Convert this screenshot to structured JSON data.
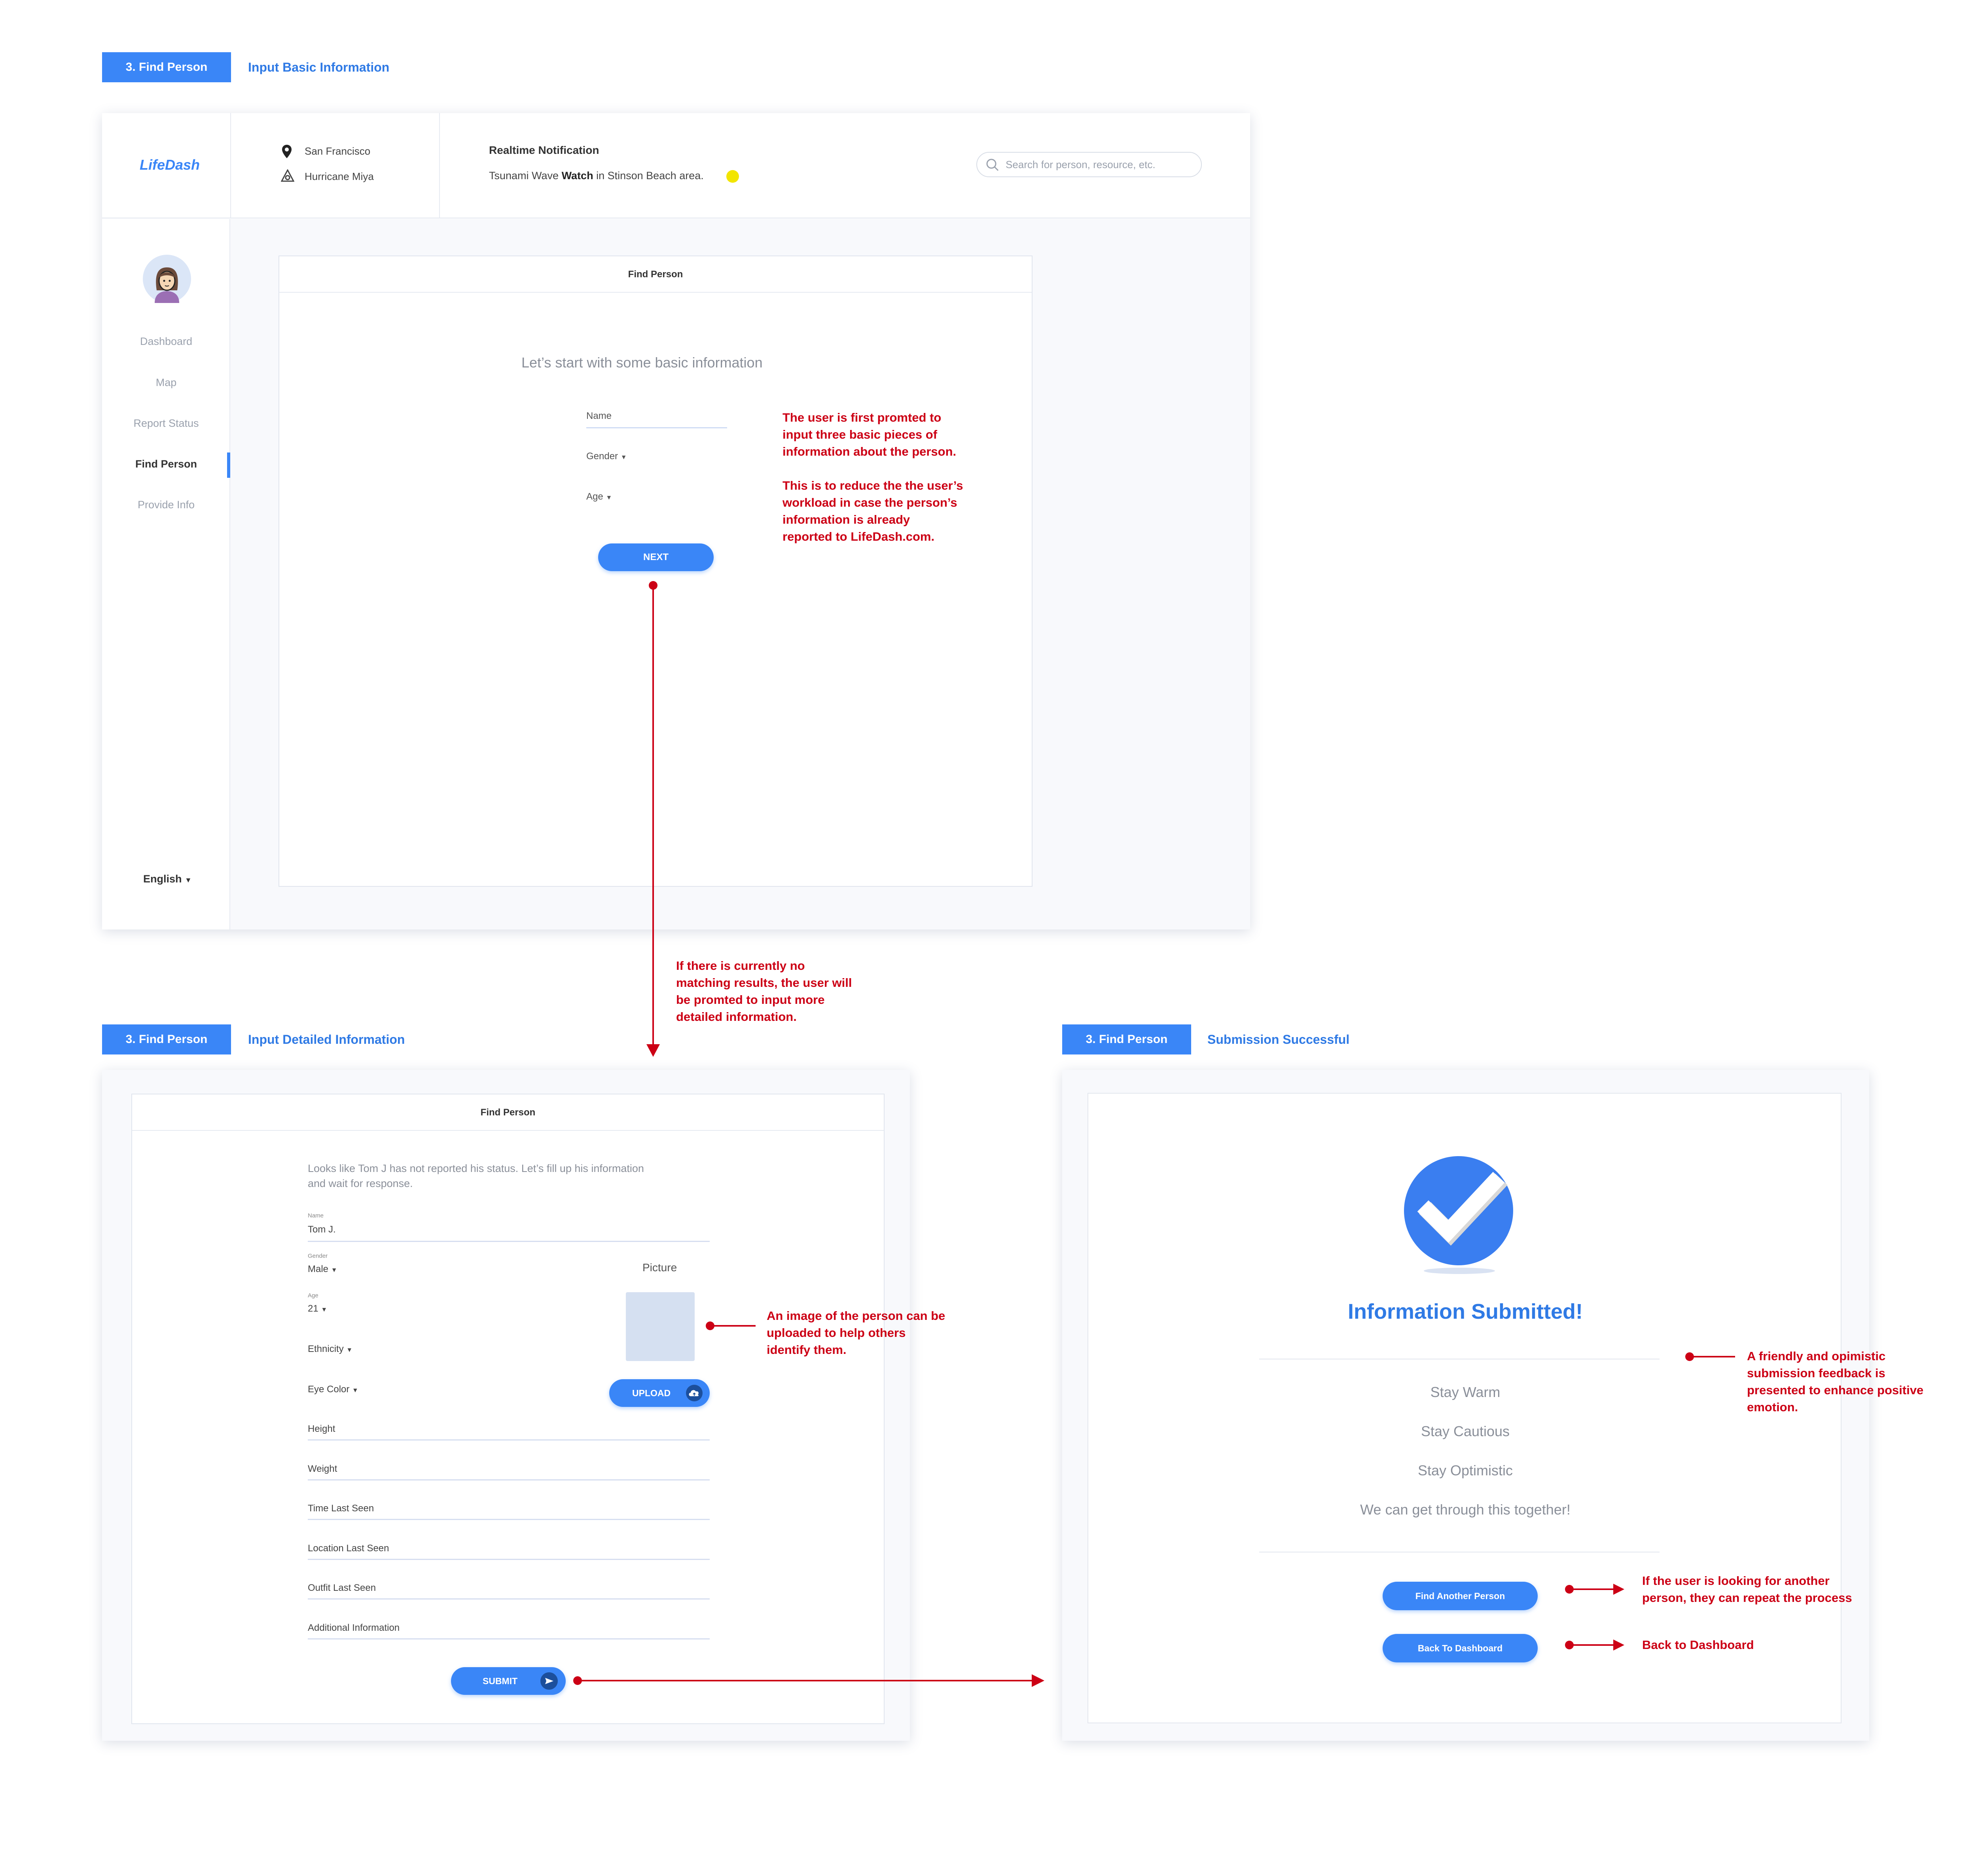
{
  "section1": {
    "tag": "3. Find Person",
    "subtitle": "Input Basic Information"
  },
  "section2": {
    "tag": "3. Find Person",
    "subtitle": "Input Detailed Information"
  },
  "section3": {
    "tag": "3. Find Person",
    "subtitle": "Submission Successful"
  },
  "app": {
    "logo": "LifeDash"
  },
  "header": {
    "location": "San Francisco",
    "hazard": "Hurricane Miya",
    "notif_title": "Realtime Notification",
    "notif_pre": "Tsunami Wave ",
    "notif_bold": "Watch",
    "notif_post": " in Stinson Beach area.",
    "search_placeholder": "Search for person, resource, etc."
  },
  "sidebar": {
    "items": [
      {
        "label": "Dashboard"
      },
      {
        "label": "Map"
      },
      {
        "label": "Report Status"
      },
      {
        "label": "Find Person"
      },
      {
        "label": "Provide Info"
      }
    ],
    "language": "English"
  },
  "basic_form": {
    "card_title": "Find Person",
    "heading": "Let’s start with some basic information",
    "name_label": "Name",
    "gender_label": "Gender",
    "age_label": "Age",
    "next_label": "NEXT"
  },
  "detail_form": {
    "card_title": "Find Person",
    "intro_line1": "Looks like Tom J has not reported his status. Let’s fill up his information",
    "intro_line2": "and wait for response.",
    "name_small": "Name",
    "name_value": "Tom J.",
    "gender_small": "Gender",
    "gender_value": "Male",
    "age_small": "Age",
    "age_value": "21",
    "ethnicity": "Ethnicity",
    "eye_color": "Eye Color",
    "height": "Height",
    "weight": "Weight",
    "time_last_seen": "Time Last Seen",
    "location_last_seen": "Location Last Seen",
    "outfit_last_seen": "Outfit Last Seen",
    "additional_info": "Additional Information",
    "picture_label": "Picture",
    "upload_label": "UPLOAD",
    "submit_label": "SUBMIT"
  },
  "success": {
    "title": "Information Submitted!",
    "line1": "Stay Warm",
    "line2": "Stay Cautious",
    "line3": "Stay Optimistic",
    "line4": "We can get through this together!",
    "find_another": "Find Another Person",
    "back_dashboard": "Back To Dashboard"
  },
  "annotations": {
    "a1_p1": [
      "The user is first promted to",
      "input three basic pieces of",
      "information about the person."
    ],
    "a1_p2": [
      "This is to reduce the the user’s",
      "workload in case the person’s",
      "information is already",
      "reported to LifeDash.com."
    ],
    "a2": [
      "If there is currently no",
      "matching results, the user will",
      "be promted to input more",
      "detailed information."
    ],
    "a3": [
      "An image of the person can be",
      "uploaded to help others",
      "identify them."
    ],
    "a4": [
      "A friendly and opimistic",
      "submission feedback is",
      "presented to enhance positive",
      "emotion."
    ],
    "a5": [
      "If the user is looking for another",
      "person, they can repeat the process"
    ],
    "a6": "Back to Dashboard"
  },
  "colors": {
    "accent": "#3a86f7",
    "annotation": "#cc0015",
    "notification_dot": "#f2e500"
  }
}
